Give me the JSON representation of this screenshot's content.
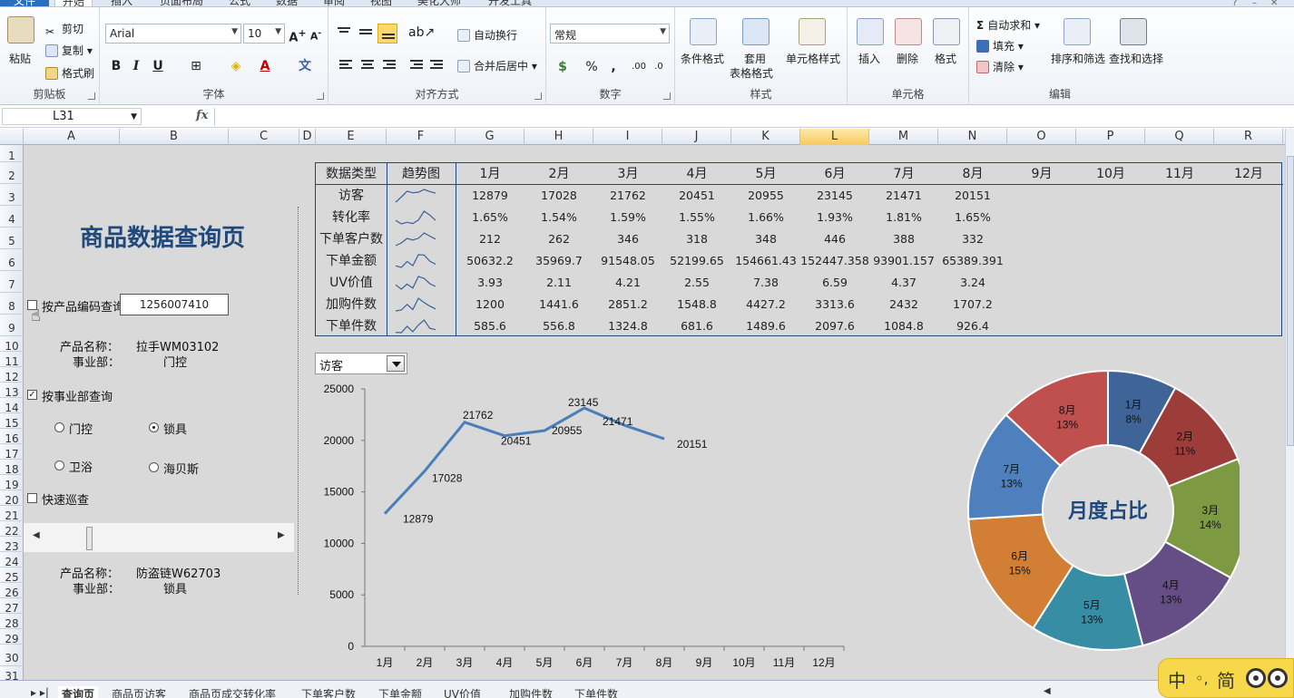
{
  "ribbon": {
    "tabs": [
      "文件",
      "开始",
      "插入",
      "页面布局",
      "公式",
      "数据",
      "审阅",
      "视图",
      "美化大师",
      "开发工具"
    ],
    "clipboard": {
      "paste": "粘贴",
      "cut": "剪切",
      "copy": "复制",
      "painter": "格式刷",
      "label": "剪贴板"
    },
    "font": {
      "name": "Arial",
      "size": "10",
      "label": "字体"
    },
    "align": {
      "wrap": "自动换行",
      "merge": "合并后居中",
      "label": "对齐方式"
    },
    "number": {
      "format": "常规",
      "label": "数字"
    },
    "styles": {
      "cond": "条件格式",
      "table_1": "套用",
      "table_2": "表格格式",
      "cell": "单元格样式",
      "label": "样式"
    },
    "cells": {
      "insert": "插入",
      "delete": "删除",
      "format": "格式",
      "label": "单元格"
    },
    "edit": {
      "autosum": "自动求和",
      "fill": "填充",
      "clear": "清除",
      "sort": "排序和筛选",
      "find": "查找和选择",
      "label": "编辑"
    }
  },
  "formula_bar": {
    "name_box": "L31",
    "fx": "fx"
  },
  "columns": [
    "A",
    "B",
    "C",
    "D",
    "E",
    "F",
    "G",
    "H",
    "I",
    "J",
    "K",
    "L",
    "M",
    "N",
    "O",
    "P",
    "Q",
    "R"
  ],
  "rows": [
    "1",
    "2",
    "3",
    "4",
    "5",
    "6",
    "7",
    "8",
    "9",
    "10",
    "11",
    "12",
    "13",
    "14",
    "15",
    "16",
    "17",
    "18",
    "19",
    "20",
    "21",
    "22",
    "23",
    "24",
    "25",
    "26",
    "27",
    "28",
    "29",
    "30",
    "31"
  ],
  "panel": {
    "title": "商品数据查询页",
    "by_code_label": "按产品编码查询",
    "code_value": "1256007410",
    "product_name_label": "产品名称：",
    "product_name_1": "拉手WM03102",
    "division_label": "事业部：",
    "division_1": "门控",
    "by_division_label": "按事业部查询",
    "radio": [
      "门控",
      "锁具",
      "卫浴",
      "海贝斯"
    ],
    "quick_label": "快速巡查",
    "product_name_2": "防盗链W62703",
    "division_2": "锁具"
  },
  "table": {
    "header_type": "数据类型",
    "header_trend": "趋势图",
    "months": [
      "1月",
      "2月",
      "3月",
      "4月",
      "5月",
      "6月",
      "7月",
      "8月",
      "9月",
      "10月",
      "11月",
      "12月"
    ],
    "rows": [
      {
        "label": "访客",
        "values": [
          "12879",
          "17028",
          "21762",
          "20451",
          "20955",
          "23145",
          "21471",
          "20151"
        ]
      },
      {
        "label": "转化率",
        "values": [
          "1.65%",
          "1.54%",
          "1.59%",
          "1.55%",
          "1.66%",
          "1.93%",
          "1.81%",
          "1.65%"
        ]
      },
      {
        "label": "下单客户数",
        "values": [
          "212",
          "262",
          "346",
          "318",
          "348",
          "446",
          "388",
          "332"
        ]
      },
      {
        "label": "下单金额",
        "values": [
          "50632.2",
          "35969.7",
          "91548.05",
          "52199.65",
          "154661.43",
          "152447.358",
          "93901.157",
          "65389.391"
        ]
      },
      {
        "label": "UV价值",
        "values": [
          "3.93",
          "2.11",
          "4.21",
          "2.55",
          "7.38",
          "6.59",
          "4.37",
          "3.24"
        ]
      },
      {
        "label": "加购件数",
        "values": [
          "1200",
          "1441.6",
          "2851.2",
          "1548.8",
          "4427.2",
          "3313.6",
          "2432",
          "1707.2"
        ]
      },
      {
        "label": "下单件数",
        "values": [
          "585.6",
          "556.8",
          "1324.8",
          "681.6",
          "1489.6",
          "2097.6",
          "1084.8",
          "926.4"
        ]
      }
    ]
  },
  "selector": {
    "value": "访客"
  },
  "chart_data": [
    {
      "type": "line",
      "categories": [
        "1月",
        "2月",
        "3月",
        "4月",
        "5月",
        "6月",
        "7月",
        "8月",
        "9月",
        "10月",
        "11月",
        "12月"
      ],
      "values": [
        12879,
        17028,
        21762,
        20451,
        20955,
        23145,
        21471,
        20151
      ],
      "ylim": [
        0,
        25000
      ],
      "yticks": [
        0,
        5000,
        10000,
        15000,
        20000,
        25000
      ],
      "color": "#4a7ebb"
    },
    {
      "type": "pie",
      "title": "月度占比",
      "slices": [
        {
          "label": "1月",
          "percent": "8%",
          "value": 8,
          "color": "#3f6598"
        },
        {
          "label": "2月",
          "percent": "11%",
          "value": 11,
          "color": "#9c3d3a"
        },
        {
          "label": "3月",
          "percent": "14%",
          "value": 14,
          "color": "#7d9a42"
        },
        {
          "label": "4月",
          "percent": "13%",
          "value": 13,
          "color": "#654e86"
        },
        {
          "label": "5月",
          "percent": "13%",
          "value": 13,
          "color": "#378ea4"
        },
        {
          "label": "6月",
          "percent": "15%",
          "value": 15,
          "color": "#d27f35"
        },
        {
          "label": "7月",
          "percent": "13%",
          "value": 13,
          "color": "#4e80bd"
        },
        {
          "label": "8月",
          "percent": "13%",
          "value": 13,
          "color": "#c0504d"
        }
      ]
    }
  ],
  "sheets": [
    "查询页",
    "商品页访客",
    "商品页成交转化率",
    "下单客户数",
    "下单金额",
    "UV价值",
    "加购件数",
    "下单件数"
  ],
  "ime": {
    "text_1": "中",
    "text_2": "◦,",
    "text_3": "简"
  }
}
